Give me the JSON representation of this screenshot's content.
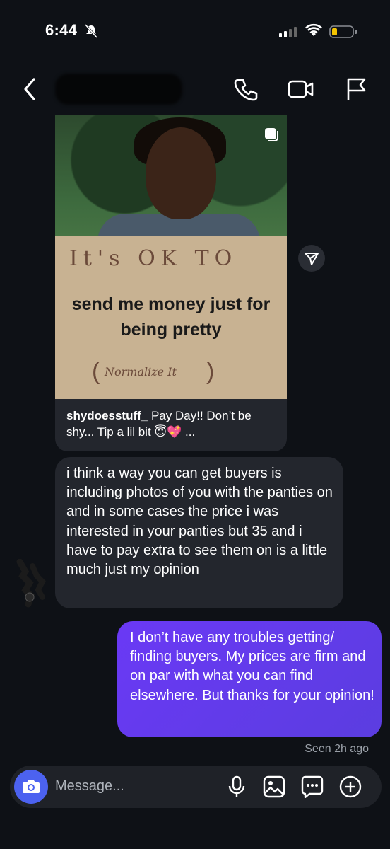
{
  "status_bar": {
    "time": "6:44"
  },
  "header": {
    "contact_name": ""
  },
  "shared_post": {
    "sign_text_line1": "It's OK TO",
    "sign_text_line2": "send me money just for being pretty",
    "sign_text_line3": "Normalize It",
    "username": "shydoesstuff_",
    "caption": "Pay Day!! Don’t be shy... Tip a lil bit 😇💖 ..."
  },
  "messages": [
    {
      "from": "them",
      "text": "i think a way you can get buyers is including photos of you with the panties on and in some cases the price  i was interested in your panties but 35 and i have to pay extra to see them on is a little much just my opinion"
    },
    {
      "from": "me",
      "text": "I don’t have any troubles getting/ finding buyers. My prices are firm and on par with what you can find elsewhere. But thanks for your opinion!"
    }
  ],
  "seen_status": "Seen 2h ago",
  "composer": {
    "placeholder": "Message..."
  },
  "colors": {
    "background": "#0e1116",
    "bubble_in": "#23262d",
    "bubble_out": "#6a39f5",
    "camera_button": "#4c62f0"
  }
}
